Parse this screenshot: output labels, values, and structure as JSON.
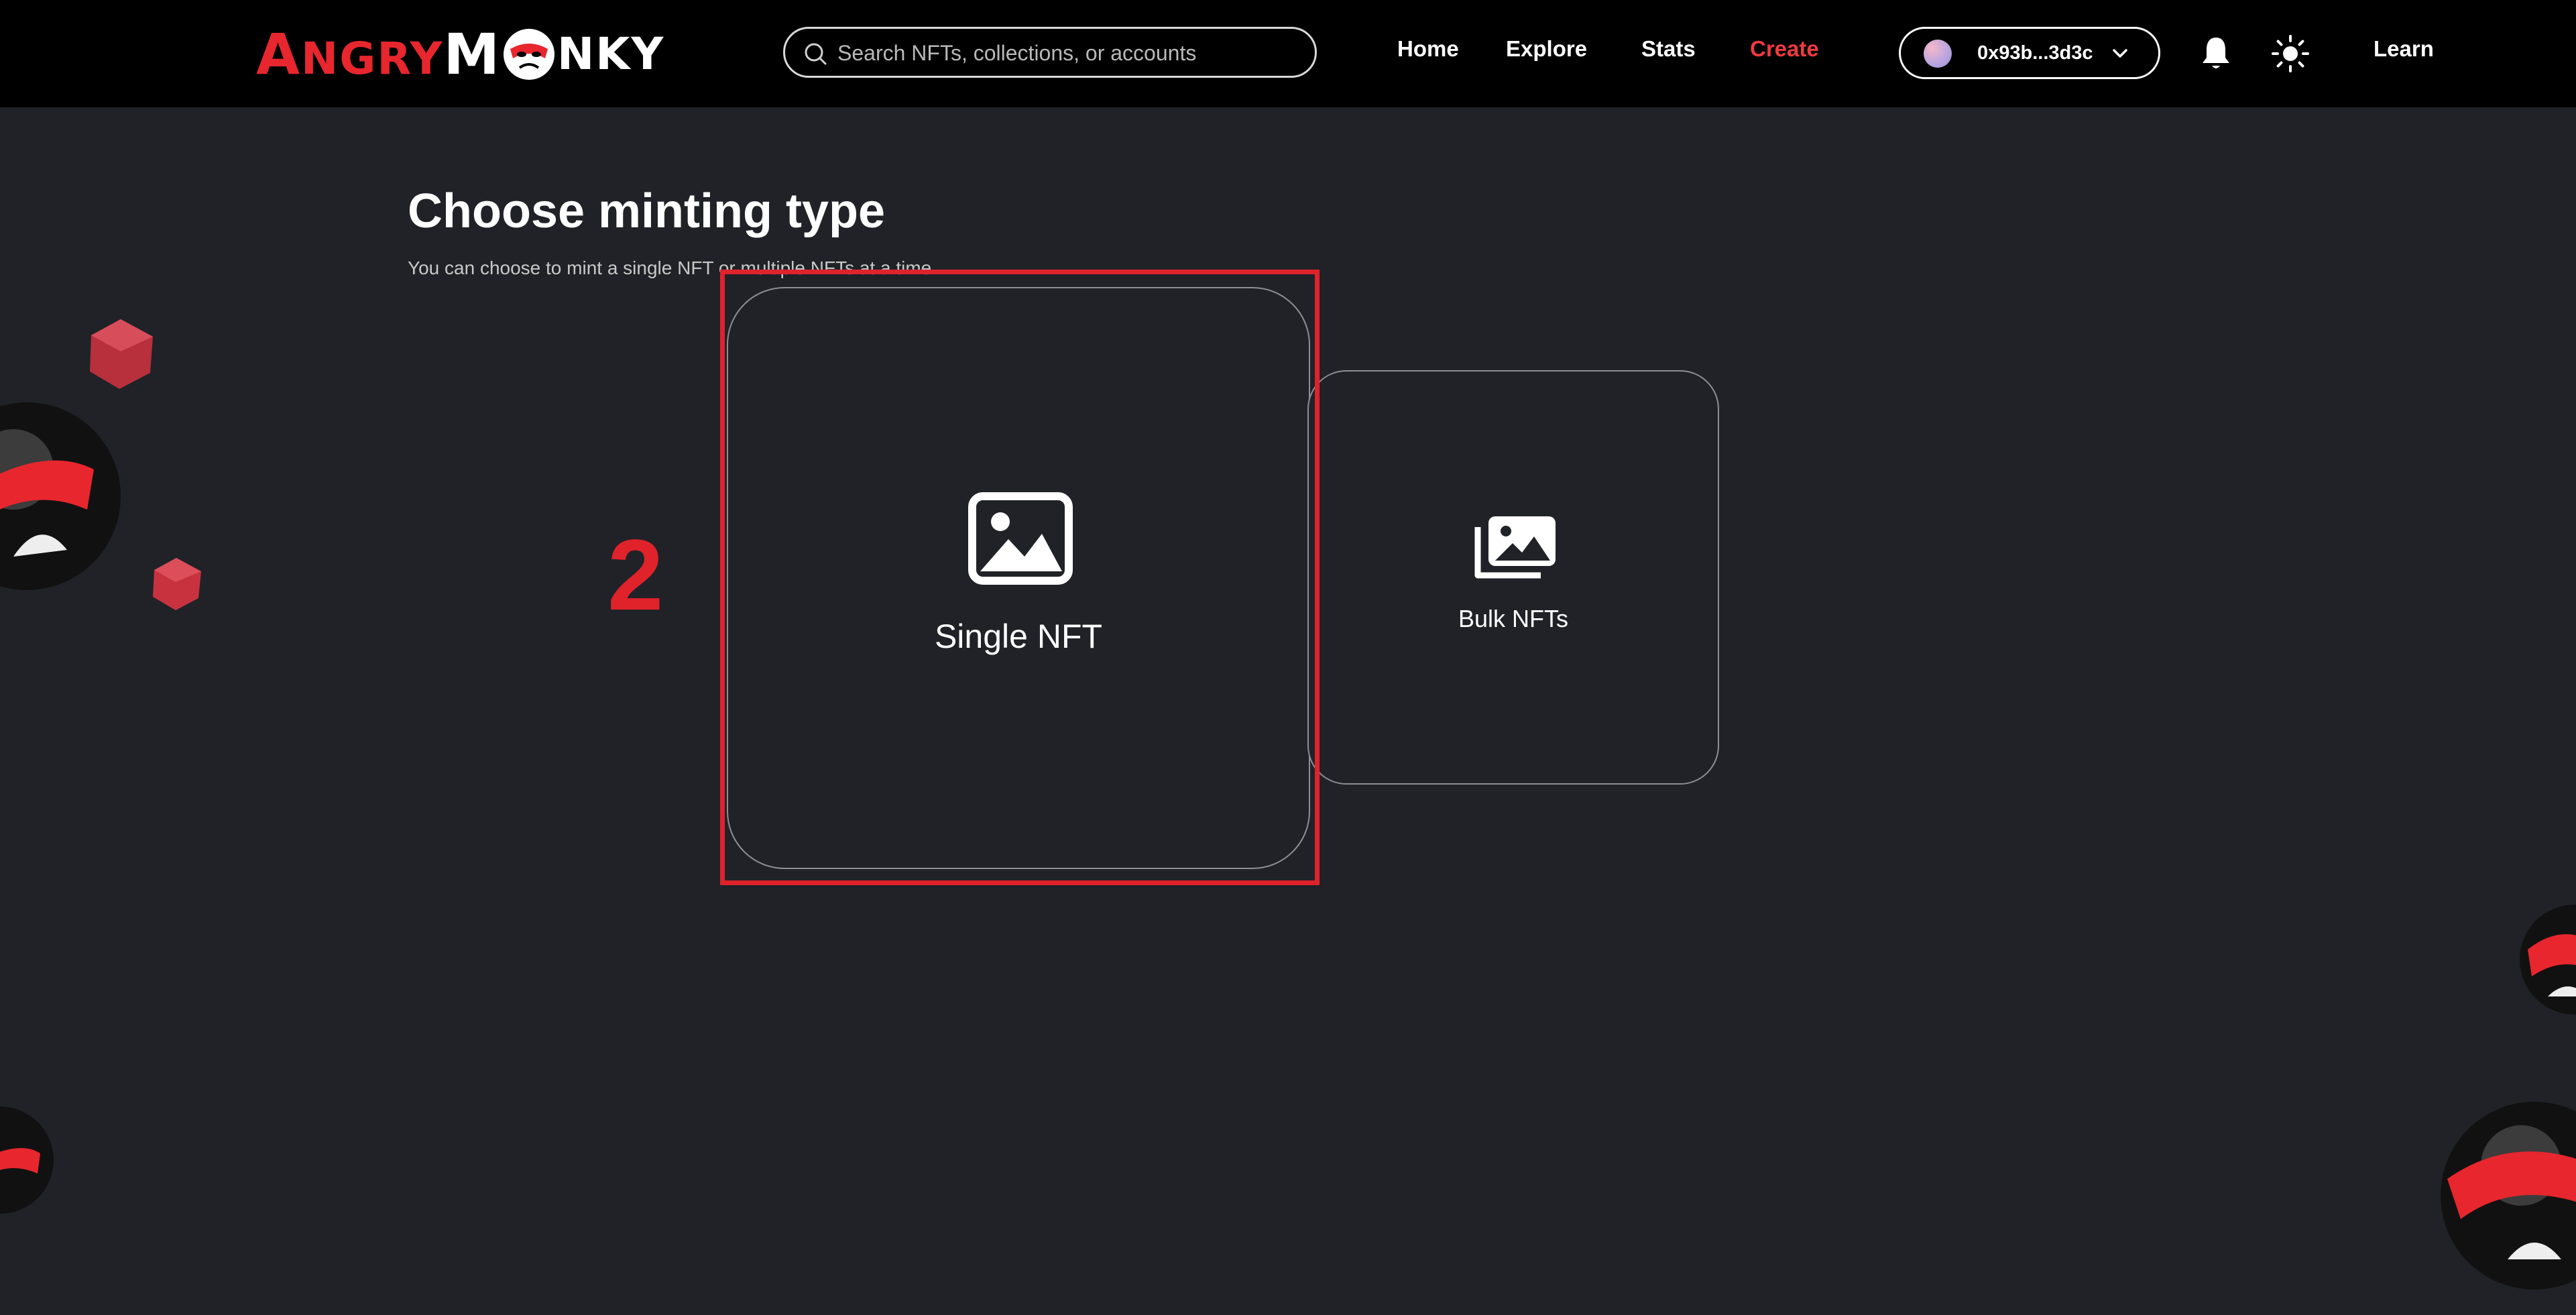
{
  "header": {
    "logo": {
      "part1": "ANGRY",
      "part2": "M",
      "part3": "NKY",
      "part1_big": "A",
      "part1_rest": "NGRY",
      "part3_big": "M"
    },
    "search": {
      "placeholder": "Search NFTs, collections, or accounts",
      "value": ""
    },
    "nav": [
      {
        "label": "Home",
        "active": false
      },
      {
        "label": "Explore",
        "active": false
      },
      {
        "label": "Stats",
        "active": false
      },
      {
        "label": "Create",
        "active": true
      }
    ],
    "wallet": {
      "address": "0x93b...3d3c"
    },
    "learn_label": "Learn"
  },
  "main": {
    "title": "Choose minting type",
    "subtitle": "You can choose to mint a single NFT or multiple NFTs at a time.",
    "options": [
      {
        "label": "Single NFT",
        "icon": "image-icon",
        "selected": true
      },
      {
        "label": "Bulk NFTs",
        "icon": "images-stack-icon",
        "selected": false
      }
    ]
  },
  "annotation": {
    "step": "2"
  },
  "colors": {
    "accent": "#e0222b",
    "background": "#202227",
    "header": "#000000",
    "active_nav": "#f03a3f"
  }
}
